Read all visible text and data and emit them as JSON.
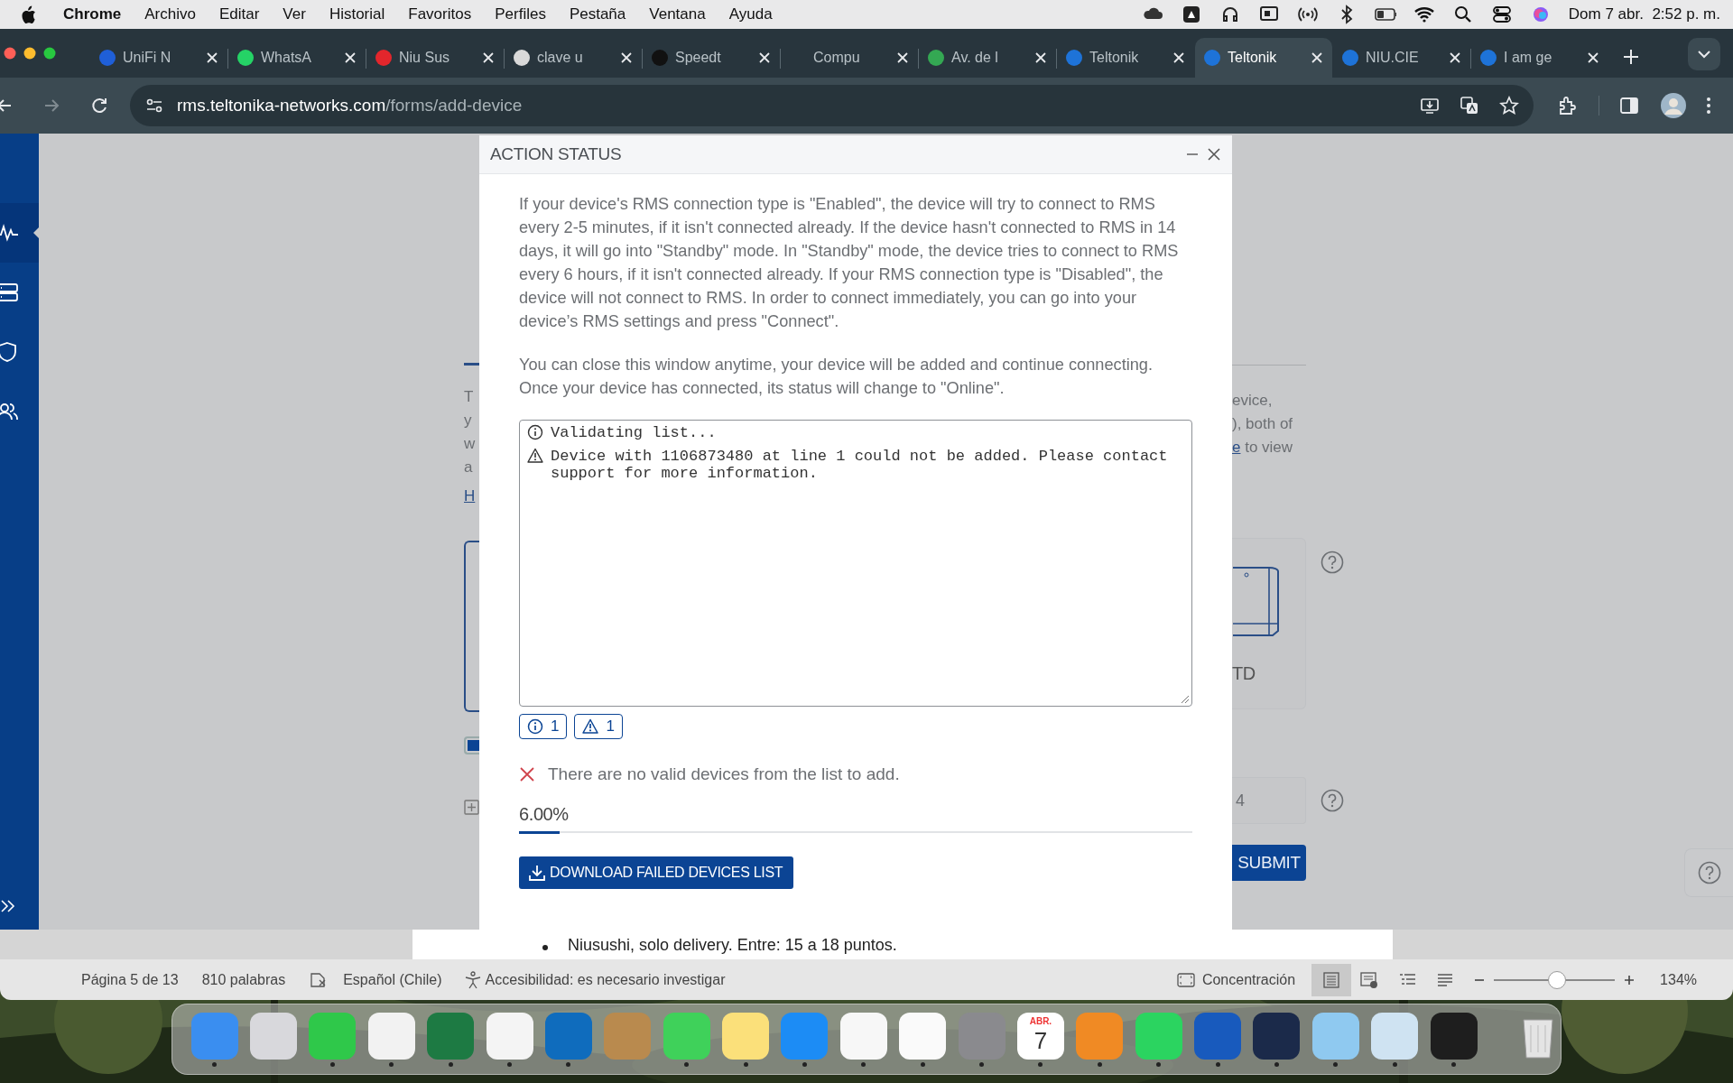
{
  "menubar": {
    "app": "Chrome",
    "menus": [
      "Archivo",
      "Editar",
      "Ver",
      "Historial",
      "Favoritos",
      "Perfiles",
      "Pestaña",
      "Ventana",
      "Ayuda"
    ],
    "clock": "Dom 7 abr.  2:52 p. m."
  },
  "browser": {
    "tabs": [
      {
        "label": "UniFi N",
        "color": "#1f5fd8",
        "selected": false
      },
      {
        "label": "WhatsA",
        "color": "#25d366",
        "selected": false
      },
      {
        "label": "Niu Sus",
        "color": "#e3262c",
        "selected": false
      },
      {
        "label": "clave u",
        "color": "#d9d9d9",
        "selected": false
      },
      {
        "label": "Speedt",
        "color": "#111111",
        "selected": false
      },
      {
        "label": "Compu",
        "selected": false
      },
      {
        "label": "Av. de l",
        "color": "#34a853",
        "selected": false
      },
      {
        "label": "Teltonik",
        "color": "#1e73d8",
        "selected": false
      },
      {
        "label": "Teltonik",
        "color": "#1e73d8",
        "selected": true
      },
      {
        "label": "NIU.CIE",
        "color": "#1e73d8",
        "selected": false
      },
      {
        "label": "I am ge",
        "color": "#1e73d8",
        "selected": false
      }
    ],
    "url_host": "rms.teltonika-networks.com",
    "url_path": "/forms/add-device"
  },
  "sidebar": {
    "items": [
      {
        "kind": "activity",
        "selected": true
      },
      {
        "kind": "servers",
        "selected": false
      },
      {
        "kind": "shield",
        "selected": false
      },
      {
        "kind": "users",
        "selected": false
      }
    ]
  },
  "background_page": {
    "left_lines": [
      "T",
      "y",
      "w",
      "a"
    ],
    "left_link": "H",
    "right_lines": [
      "evice,",
      "), both of"
    ],
    "right_link": "e",
    "right_after_link": "to view",
    "device_label": "TD",
    "input_value": "4",
    "submit": "SUBMIT",
    "checkbox_checked": true
  },
  "modal": {
    "title": "ACTION STATUS",
    "paragraphs": [
      "If your device's RMS connection type is \"Enabled\", the device will try to connect to RMS every 2-5 minutes, if it isn't connected already. If the device hasn't connected to RMS in 14 days, it will go into \"Standby\" mode. In \"Standby\" mode, the device tries to connect to RMS every 6 hours, if it isn't connected already. If your RMS connection type is \"Disabled\", the device will not connect to RMS. In order to connect immediately, you can go into your device’s RMS settings and press \"Connect\".",
      "You can close this window anytime, your device will be added and continue connecting. Once your device has connected, its status will change to \"Online\"."
    ],
    "log": [
      {
        "kind": "info",
        "text": "Validating list..."
      },
      {
        "kind": "warning",
        "text": "Device with 1106873480 at line 1 could not be added. Please contact support for more information."
      }
    ],
    "counters": [
      {
        "kind": "info",
        "count": "1"
      },
      {
        "kind": "warning",
        "count": "1"
      }
    ],
    "error": "There are no valid devices from the list to add.",
    "progress": {
      "reading": "6.00%",
      "level": 0.06
    },
    "download_button": "DOWNLOAD FAILED DEVICES LIST"
  },
  "word": {
    "doc_line": "Niusushi, solo delivery. Entre: 15 a 18 puntos.",
    "status": [
      "Página 5 de 13",
      "810 palabras",
      "Español (Chile)",
      "Accesibilidad: es necesario investigar"
    ],
    "focus": "Concentración",
    "zoom": {
      "level": 0.52,
      "reading": "134%"
    }
  },
  "dock": {
    "apps": [
      {
        "color": "#3a8ef0",
        "running": true
      },
      {
        "color": "#d8d8dc",
        "running": false
      },
      {
        "color": "#2fc84a",
        "running": true
      },
      {
        "color": "#f2f2f2",
        "running": true
      },
      {
        "color": "#1d7a43",
        "running": true
      },
      {
        "color": "#f4f4f4",
        "running": true
      },
      {
        "color": "#0f6cbd",
        "running": true
      },
      {
        "color": "#b98a4e",
        "running": false
      },
      {
        "color": "#3fd15a",
        "running": true
      },
      {
        "color": "#fbe07a",
        "running": true
      },
      {
        "color": "#1c8cf5",
        "running": true
      },
      {
        "color": "#f7f7f7",
        "running": true
      },
      {
        "color": "#fafafa",
        "running": true
      },
      {
        "color": "#8a8a8e",
        "running": true
      },
      {
        "kind": "calendar",
        "month": "ABR.",
        "day": "7",
        "running": true
      },
      {
        "color": "#f08a24",
        "running": true
      },
      {
        "color": "#2bd460",
        "running": true
      },
      {
        "color": "#185abd",
        "running": true
      },
      {
        "color": "#1b2a4a",
        "running": true
      },
      {
        "color": "#8fc9f0",
        "running": true
      },
      {
        "color": "#cfe3f2",
        "running": true
      },
      {
        "color": "#1e1e1e",
        "running": true
      },
      {
        "kind": "trash",
        "running": false
      }
    ]
  }
}
